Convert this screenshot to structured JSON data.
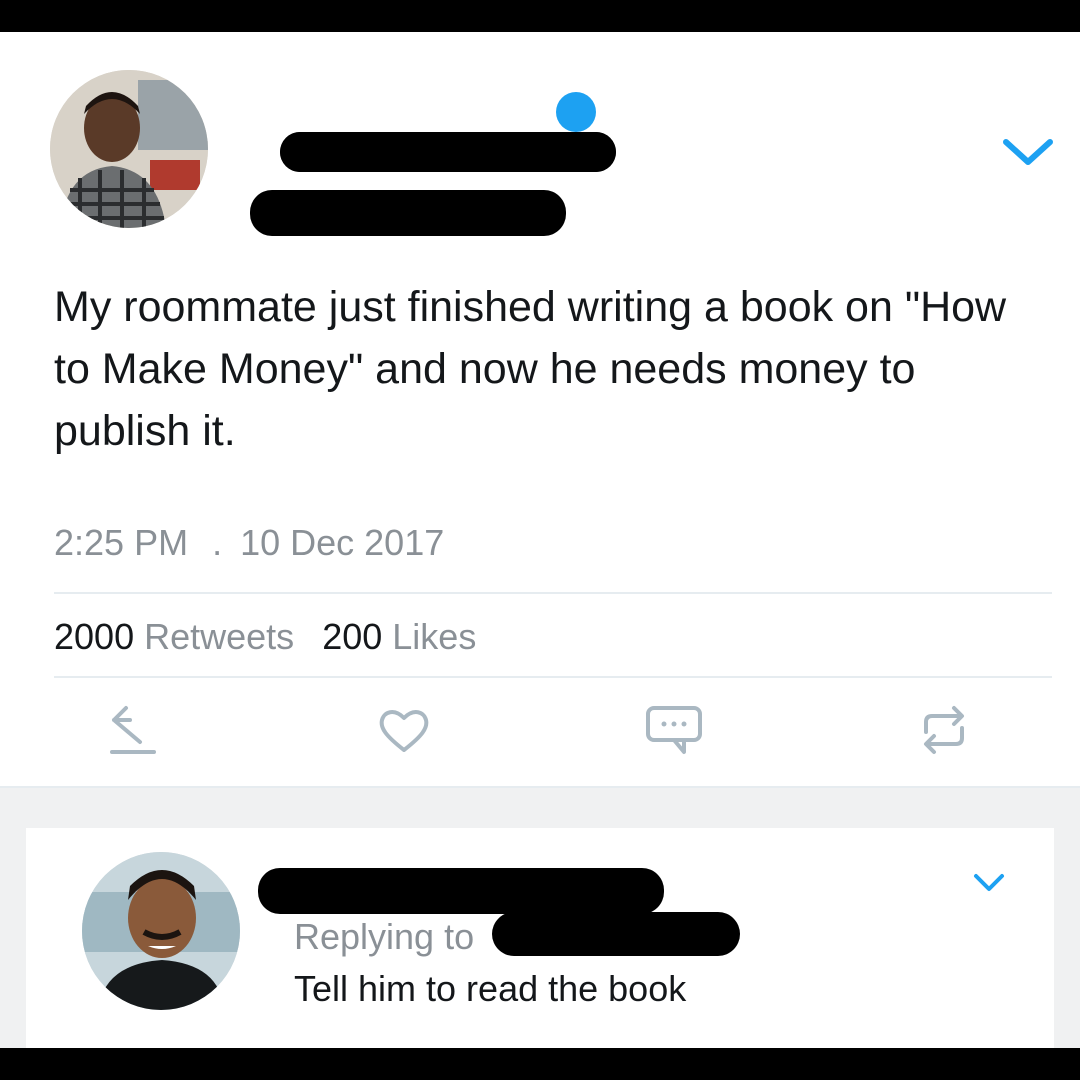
{
  "tweet": {
    "text": "My roommate just finished writing a book on \"How to Make Money\" and now he needs money to publish it.",
    "time": "2:25 PM",
    "separator": ".",
    "date": "10 Dec 2017",
    "retweets_count": "2000",
    "retweets_label": "Retweets",
    "likes_count": "200",
    "likes_label": "Likes"
  },
  "reply": {
    "replying_label": "Replying to",
    "text": "Tell him to read the book"
  },
  "icons": {
    "menu": "chevron-down-icon",
    "reply": "reply-icon",
    "like": "heart-icon",
    "message": "message-icon",
    "retweet": "retweet-icon"
  },
  "colors": {
    "accent": "#1da1f2",
    "text": "#14171a",
    "muted": "#8a9096"
  }
}
